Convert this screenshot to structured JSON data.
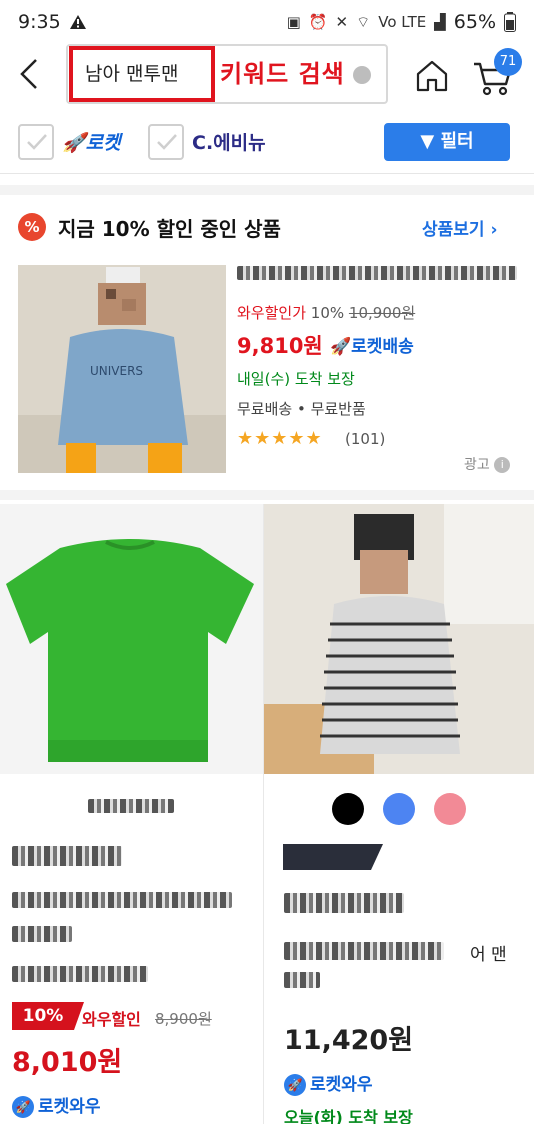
{
  "status_bar": {
    "time": "9:35",
    "battery": "65%",
    "warning_icon": "warning-icon",
    "network": "Vo LTE"
  },
  "header": {
    "query": "남아 맨투맨",
    "annotation": "키워드 검색",
    "cart_count": "71",
    "colors": {
      "highlight": "#e0141e",
      "accent": "#2b7de9"
    }
  },
  "filters": {
    "rocket_label": "로켓",
    "ceb_label": "C.에비뉴",
    "filter_button": "필터"
  },
  "promo": {
    "icon": "%",
    "title": "지금 10% 할인 중인 상품",
    "more": "상품보기",
    "item": {
      "discount_label": "와우할인가",
      "discount_rate": "10%",
      "original_price": "10,900원",
      "price": "9,810원",
      "delivery": "로켓배송",
      "arrival": "내일(수) 도착 보장",
      "shipping": "무료배송 • 무료반품",
      "rating": 5,
      "reviews": "(101)",
      "ad_label": "광고"
    }
  },
  "products": [
    {
      "discount_rate": "10%",
      "wow_label": "와우할인",
      "original_price": "8,900원",
      "price": "8,010원",
      "delivery": "로켓와우"
    },
    {
      "swatches": [
        "#000000",
        "#4d84f2",
        "#f28a96"
      ],
      "title_tail": "어 맨",
      "price": "11,420원",
      "delivery": "로켓와우",
      "arrival": "오늘(화) 도착 보장"
    }
  ]
}
